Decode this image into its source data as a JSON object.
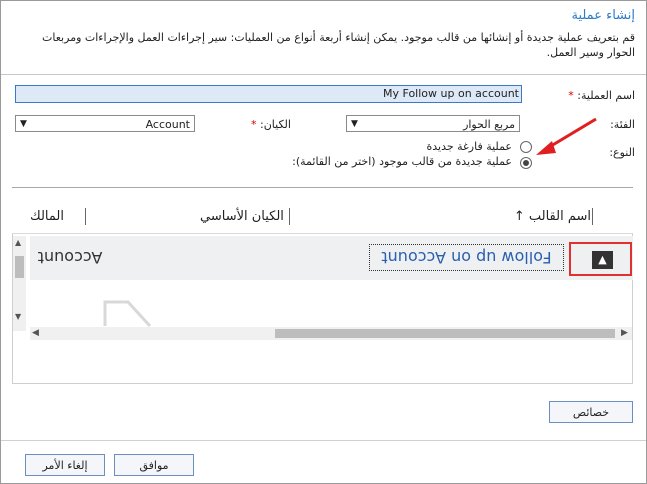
{
  "dialog": {
    "title": "إنشاء عملية",
    "description": "قم بتعريف عملية جديدة أو إنشائها من قالب موجود. يمكن إنشاء أربعة أنواع من العمليات: سير إجراءات العمل والإجراءات ومربعات الحوار وسير العمل."
  },
  "form": {
    "name_label": "اسم العملية:",
    "name_value": "My Follow up on account",
    "category_label": "الفئة:",
    "category_value": "مربع الحوار",
    "entity_label": "الكيان:",
    "entity_value": "Account",
    "type_label": "النوع:",
    "type_option_new": "عملية فارغة جديدة",
    "type_option_template": "عملية جديدة من قالب موجود (اختر من القائمة):",
    "required_mark": "*"
  },
  "grid": {
    "columns": [
      "اسم القالب",
      "الكيان الأساسي",
      "المالك"
    ],
    "sort_indicator": "↑",
    "rows": [
      {
        "template_name": "Follow up on Account",
        "primary_entity": "Account",
        "owner": ""
      }
    ]
  },
  "buttons": {
    "properties": "خصائص",
    "ok": "موافق",
    "cancel": "إلغاء الأمر"
  },
  "colors": {
    "title": "#2a7cc7",
    "highlight_box": "#e03030",
    "arrow": "#e02020",
    "selected_field": "#dde9f7"
  },
  "icons": [
    "dropdown-arrow-icon",
    "sort-up-icon",
    "scroll-up-icon",
    "scroll-down-icon",
    "scroll-left-icon",
    "scroll-right-icon",
    "expand-up-icon",
    "red-arrow-annotation"
  ]
}
